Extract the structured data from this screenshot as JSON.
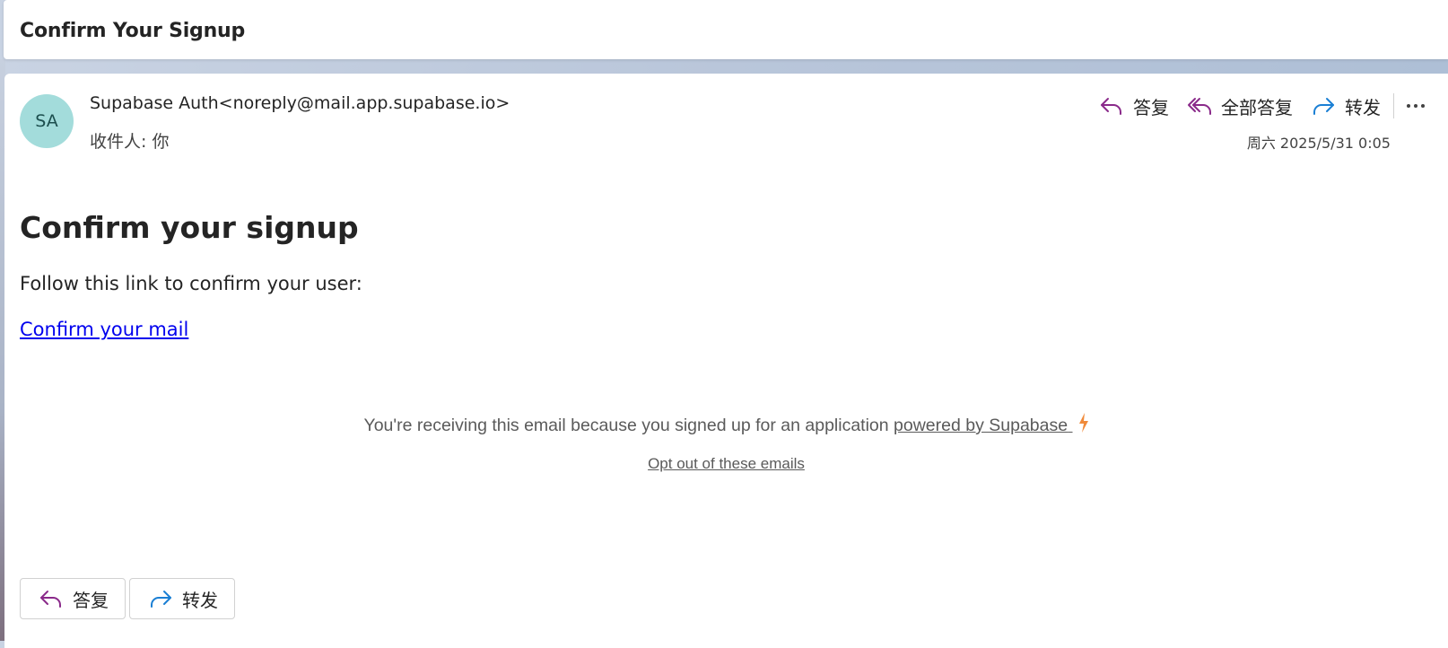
{
  "subject": "Confirm Your Signup",
  "message": {
    "avatar_initials": "SA",
    "sender": "Supabase Auth<noreply@mail.app.supabase.io>",
    "recipient": "收件人: 你",
    "date": "周六 2025/5/31 0:05"
  },
  "toolbar": {
    "reply_label": "答复",
    "reply_all_label": "全部答复",
    "forward_label": "转发"
  },
  "body": {
    "title": "Confirm your signup",
    "text": "Follow this link to confirm your user:",
    "link_label": "Confirm your mail"
  },
  "footer": {
    "text": "You're receiving this email because you signed up for an application",
    "link_label": "powered by Supabase",
    "optout_label": "Opt out of these emails"
  },
  "bottom_actions": {
    "reply_label": "答复",
    "forward_label": "转发"
  },
  "icons": {
    "reply": "reply-icon",
    "reply_all": "reply-all-icon",
    "forward": "forward-icon",
    "more": "more-icon",
    "bolt": "lightning-bolt-icon"
  },
  "colors": {
    "avatar_bg": "#a3dcdb",
    "reply_icon": "#8a2a8a",
    "forward_icon": "#1a7fd4",
    "link": "#0000ee",
    "bolt": "#f08a3a"
  }
}
